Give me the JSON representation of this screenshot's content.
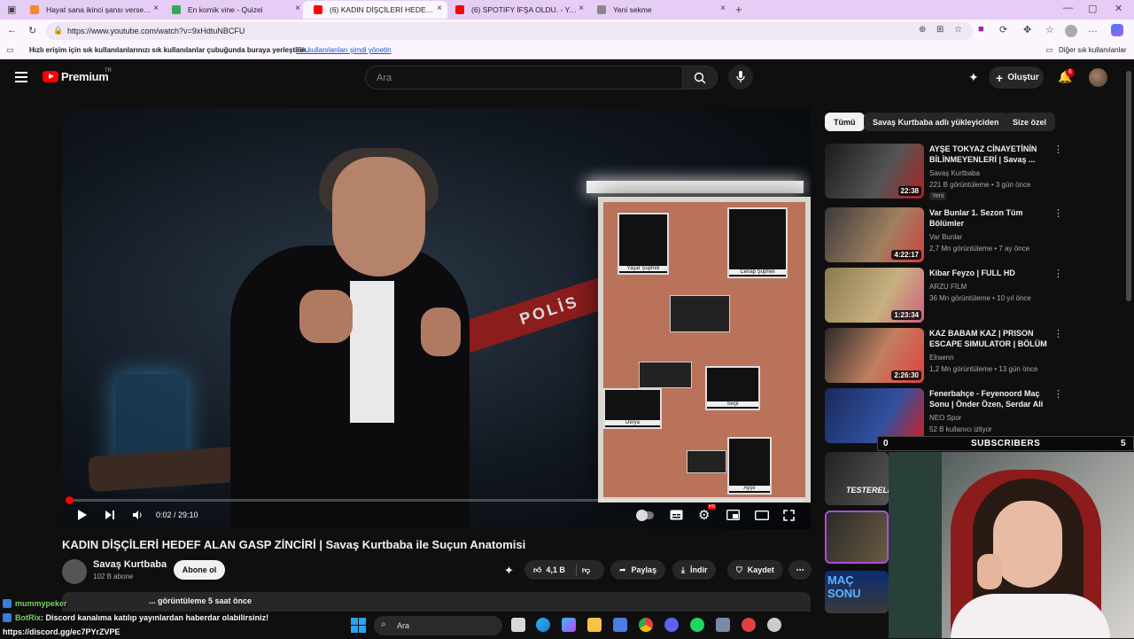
{
  "browser": {
    "tabs": [
      {
        "label": "Hayat sana ikinci şansı verseydi...",
        "fav": "#f28b30"
      },
      {
        "label": "En komik vine - Quizei",
        "fav": "#36a852"
      },
      {
        "label": "(6) KADIN DİŞÇİLERİ HEDEF ALAN...",
        "fav": "#ff0000"
      },
      {
        "label": "(6) SPOTIFY İFŞA OLDU. - YouTube",
        "fav": "#ff0000"
      },
      {
        "label": "Yeni sekme",
        "fav": "#888888"
      }
    ],
    "url": "https://www.youtube.com/watch?v=9xHdtuNBCFU",
    "bookmark_hint": "Hızlı erişim için sık kullanılanlarınızı sık kullanılanlar çubuğunda buraya yerleştirin.",
    "bookmark_link": "Sık kullanılanları şimdi yönetin",
    "other_bookmarks": "Diğer sık kullanılanlar"
  },
  "header": {
    "logo": "Premium",
    "logo_region": "TR",
    "search_placeholder": "Ara",
    "create_label": "Oluştur",
    "notification_count": "6"
  },
  "player": {
    "time": "0:02 / 29:10",
    "progress": 0.001,
    "tape_text": "POLİS",
    "photos": [
      {
        "label": "Yaşar Şüpheli"
      },
      {
        "label": "Cenap Şüpheli"
      },
      {
        "label": "Seçil"
      },
      {
        "label": "Derya"
      },
      {
        "label": "Ayşe"
      }
    ]
  },
  "video": {
    "title": "KADIN DİŞÇİLERİ HEDEF ALAN GASP ZİNCİRİ | Savaş Kurtbaba ile Suçun Anatomisi",
    "channel": "Savaş Kurtbaba",
    "subs": "102 B abone",
    "subscribe": "Abone ol",
    "likes": "4,1 B",
    "share": "Paylaş",
    "download": "İndir",
    "save": "Kaydet",
    "views": "... görüntüleme  5 saat önce"
  },
  "sidebar": {
    "chips": [
      "Tümü",
      "Savaş Kurtbaba adlı yükleyiciden",
      "Size özel"
    ],
    "recs": [
      {
        "title": "AYŞE TOKYAZ CİNAYETİNİN BİLİNMEYENLERİ | Savaş ...",
        "channel": "Savaş Kurtbaba",
        "meta": "221 B görüntüleme • 3 gün önce",
        "badge": "Yeni",
        "duration": "22:38",
        "bg": "linear-gradient(120deg,#1a1a1a,#555 60%,#b02020)"
      },
      {
        "title": "Var Bunlar 1. Sezon Tüm Bölümler",
        "channel": "Var Bunlar",
        "meta": "2,7 Mn görüntüleme • 7 ay önce",
        "duration": "4:22:17",
        "bg": "linear-gradient(120deg,#3a3a3a,#a08060 60%,#d04040)"
      },
      {
        "title": "Kibar Feyzo | FULL HD",
        "channel": "ARZU FİLM",
        "meta": "36 Mn görüntüleme • 10 yıl önce",
        "duration": "1:23:34",
        "bg": "linear-gradient(120deg,#8a7a50,#c8b080 60%,#d06080)"
      },
      {
        "title": "KAZ BABAM KAZ | PRISON ESCAPE SIMULATOR | BÖLÜM 1",
        "channel": "Elraenn",
        "meta": "1,2 Mn görüntüleme • 13 gün önce",
        "duration": "2:26:30",
        "bg": "linear-gradient(120deg,#2a2a2a,#c08060 55%,#e04040)"
      },
      {
        "title": "Fenerbahçe - Feyenoord Maç Sonu | Önder Özen, Serdar Ali ...",
        "channel": "NEO Spor",
        "meta": "52 B kullanıcı izliyor",
        "duration": "",
        "bg": "linear-gradient(120deg,#1a2a5a,#3050a0 60%,#d02020)"
      }
    ]
  },
  "stream": {
    "subscribers_label": "SUBSCRIBERS",
    "sub_left": "0",
    "sub_right": "5",
    "chat": [
      {
        "user": "mummypeker",
        "text": ""
      },
      {
        "user": "BotRix",
        "text": ": Discord kanalıma katılıp yayınlardan haberdar olabilirsiniz!"
      },
      {
        "user": "",
        "text": "https://discord.gg/ec7PYrZVPE"
      }
    ],
    "thumbs": [
      "TESTERELİ",
      "MAÇ SONU"
    ]
  },
  "taskbar": {
    "search": "Ara"
  }
}
